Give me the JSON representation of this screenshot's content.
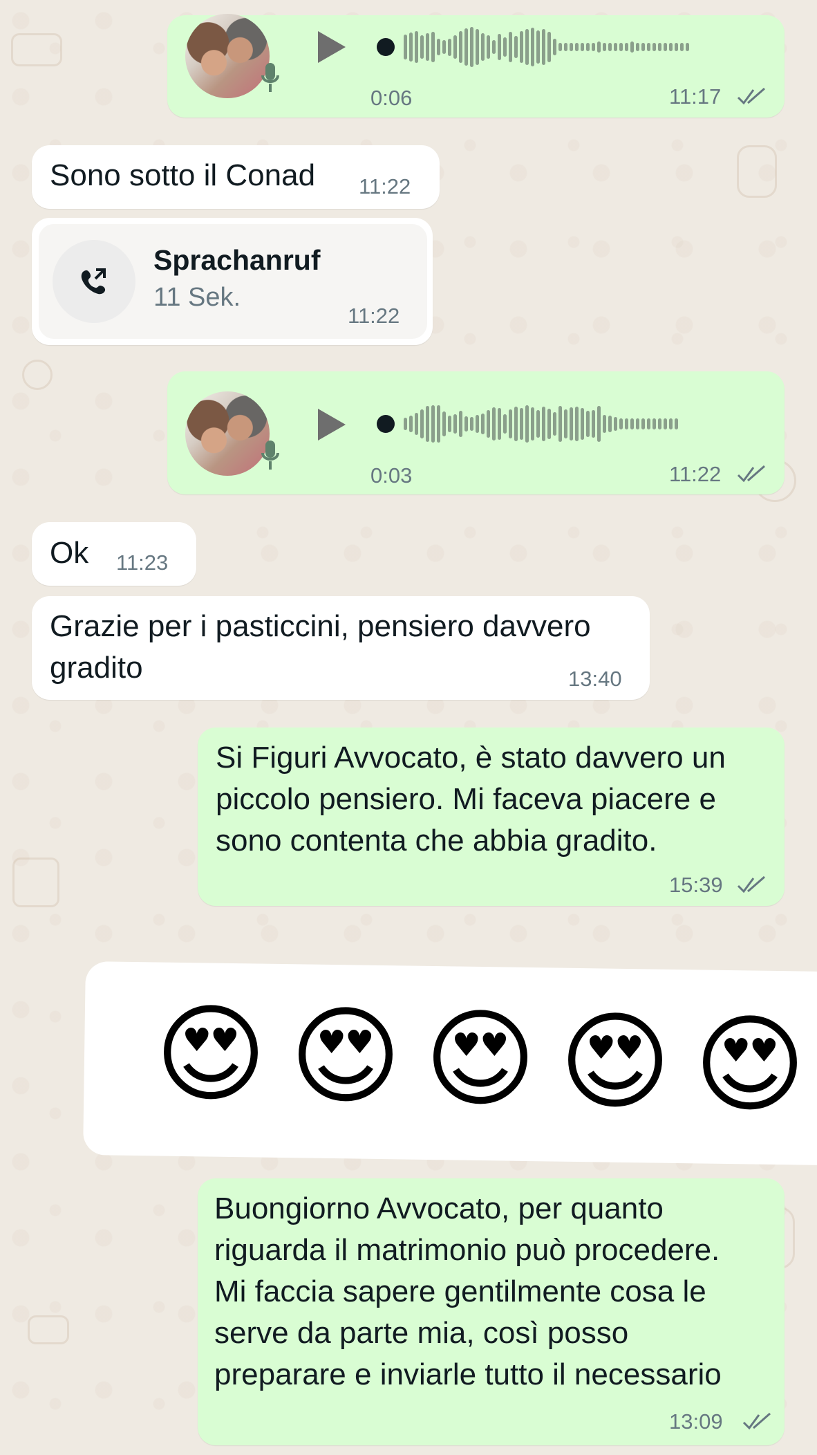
{
  "messages": {
    "voice_1": {
      "duration": "0:06",
      "time": "11:17"
    },
    "text_1": {
      "text": "Sono sotto il Conad",
      "time": "11:22"
    },
    "call": {
      "title": "Sprachanruf",
      "subtitle": "11 Sek.",
      "time": "11:22"
    },
    "voice_2": {
      "duration": "0:03",
      "time": "11:22"
    },
    "text_ok": {
      "text": "Ok",
      "time": "11:23"
    },
    "text_grazie": {
      "lines": [
        "Grazie per i pasticcini, pensiero davvero",
        "gradito"
      ],
      "time": "13:40"
    },
    "text_figuri": {
      "lines": [
        "Si Figuri Avvocato, è stato davvero un",
        "piccolo pensiero. Mi faceva piacere e",
        "sono contenta che abbia gradito."
      ],
      "time": "15:39"
    },
    "emoji_reply": {
      "emojis": [
        "😍",
        "😍",
        "😍",
        "😍",
        "😍"
      ]
    },
    "text_buongiorno": {
      "lines": [
        "Buongiorno Avvocato, per quanto",
        "riguarda il matrimonio può procedere.",
        "Mi faccia sapere gentilmente cosa le",
        "serve da parte mia, così posso",
        "preparare e inviarle tutto il necessario"
      ],
      "time": "13:09"
    }
  }
}
